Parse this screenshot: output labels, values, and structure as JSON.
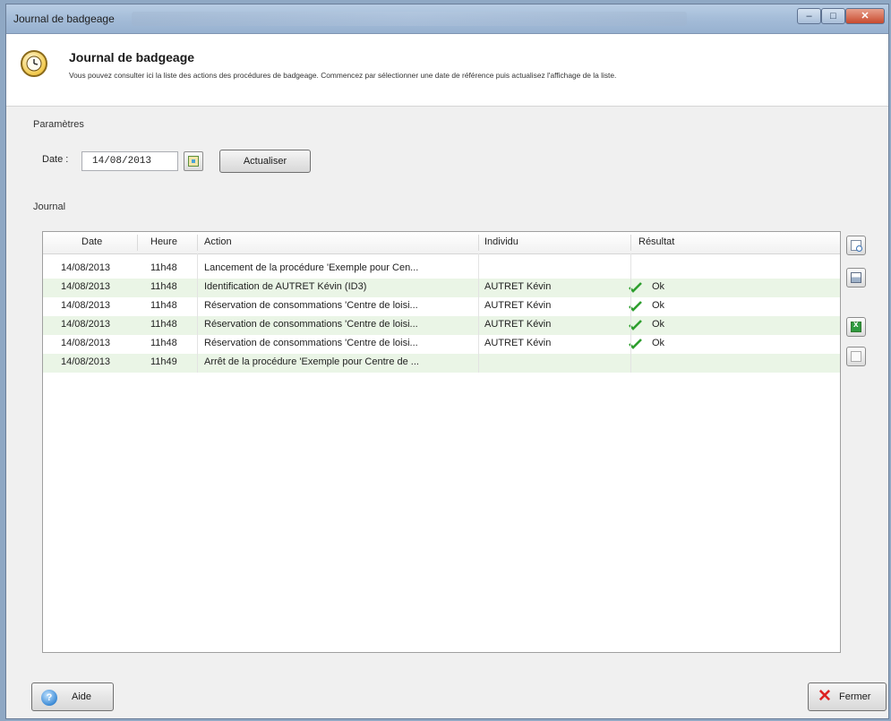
{
  "window": {
    "title": "Journal de badgeage"
  },
  "header": {
    "title": "Journal de badgeage",
    "description": "Vous pouvez consulter ici la liste des actions des procédures de badgeage. Commencez par sélectionner une date de référence puis actualisez l'affichage de la liste."
  },
  "params": {
    "section_label": "Paramètres",
    "date_label": "Date :",
    "date_value": "14/08/2013",
    "refresh_label": "Actualiser"
  },
  "journal": {
    "section_label": "Journal",
    "columns": [
      "Date",
      "Heure",
      "Action",
      "Individu",
      "Résultat"
    ],
    "rows": [
      {
        "date": "14/08/2013",
        "time": "11h48",
        "action": "Lancement de la procédure 'Exemple pour Cen...",
        "person": "",
        "result": "",
        "ok": false
      },
      {
        "date": "14/08/2013",
        "time": "11h48",
        "action": "Identification de AUTRET Kévin (ID3)",
        "person": "AUTRET Kévin",
        "result": "Ok",
        "ok": true
      },
      {
        "date": "14/08/2013",
        "time": "11h48",
        "action": "Réservation de consommations 'Centre de loisi...",
        "person": "AUTRET Kévin",
        "result": "Ok",
        "ok": true
      },
      {
        "date": "14/08/2013",
        "time": "11h48",
        "action": "Réservation de consommations 'Centre de loisi...",
        "person": "AUTRET Kévin",
        "result": "Ok",
        "ok": true
      },
      {
        "date": "14/08/2013",
        "time": "11h48",
        "action": "Réservation de consommations 'Centre de loisi...",
        "person": "AUTRET Kévin",
        "result": "Ok",
        "ok": true
      },
      {
        "date": "14/08/2013",
        "time": "11h49",
        "action": "Arrêt de la procédure 'Exemple pour Centre de ...",
        "person": "",
        "result": "",
        "ok": false
      }
    ],
    "side_tools": [
      "preview-icon",
      "print-icon",
      "excel-export-icon",
      "blank-page-icon"
    ]
  },
  "footer": {
    "help_label": "Aide",
    "close_label": "Fermer"
  },
  "colors": {
    "alt_row": "#eaf5e6",
    "check": "#2e9e2e"
  }
}
